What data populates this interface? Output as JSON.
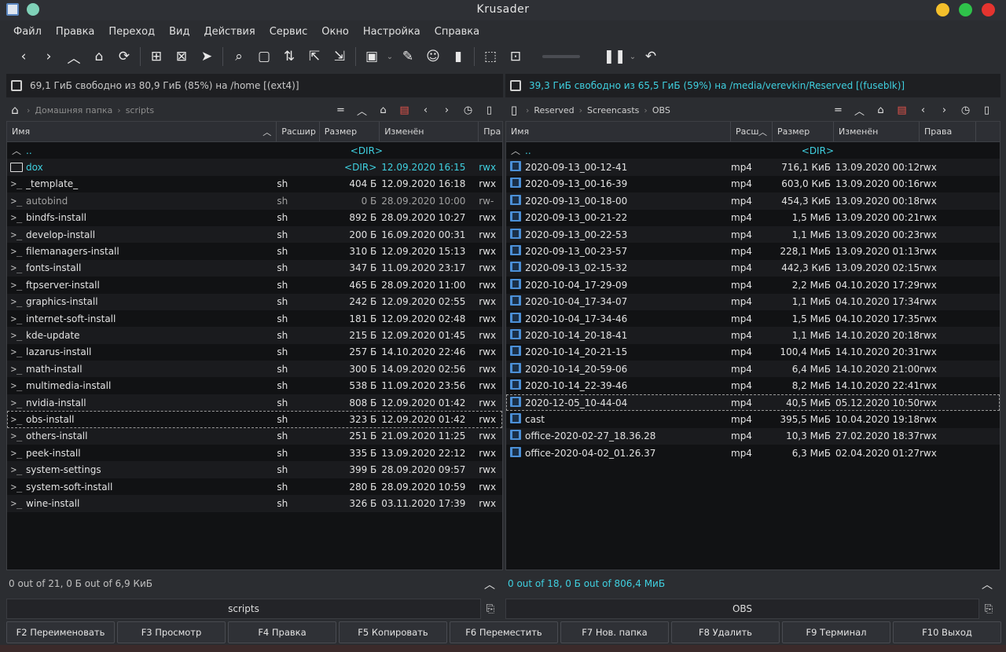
{
  "window": {
    "title": "Krusader"
  },
  "colors": {
    "accent": "#3fd0e0",
    "minimize": "#f4bf2b",
    "maximize": "#2fc24a",
    "close": "#e5342f"
  },
  "menu": [
    "Файл",
    "Правка",
    "Переход",
    "Вид",
    "Действия",
    "Сервис",
    "Окно",
    "Настройка",
    "Справка"
  ],
  "left": {
    "free": "69,1 ГиБ свободно из 80,9 ГиБ (85%) на /home [(ext4)]",
    "breadcrumb": [
      "Домашняя папка",
      "scripts"
    ],
    "columns": {
      "name": "Имя",
      "ext": "Расшир",
      "size": "Размер",
      "date": "Изменён",
      "perm": "Пра"
    },
    "updir": {
      "name": "..",
      "size": "<DIR>"
    },
    "rows": [
      {
        "icon": "folder-icon",
        "name": "dox",
        "ext": "",
        "size": "<DIR>",
        "date": "12.09.2020 16:15",
        "perm": "rwx",
        "dir": true
      },
      {
        "icon": "script-icon",
        "name": "_template_",
        "ext": "sh",
        "size": "404 Б",
        "date": "12.09.2020 16:18",
        "perm": "rwx"
      },
      {
        "icon": "script-icon",
        "name": "autobind",
        "ext": "sh",
        "size": "0 Б",
        "date": "28.09.2020 10:00",
        "perm": "rw-",
        "dim": true
      },
      {
        "icon": "script-icon",
        "name": "bindfs-install",
        "ext": "sh",
        "size": "892 Б",
        "date": "28.09.2020 10:27",
        "perm": "rwx"
      },
      {
        "icon": "script-icon",
        "name": "develop-install",
        "ext": "sh",
        "size": "200 Б",
        "date": "16.09.2020 00:31",
        "perm": "rwx"
      },
      {
        "icon": "script-icon",
        "name": "filemanagers-install",
        "ext": "sh",
        "size": "310 Б",
        "date": "12.09.2020 15:13",
        "perm": "rwx"
      },
      {
        "icon": "script-icon",
        "name": "fonts-install",
        "ext": "sh",
        "size": "347 Б",
        "date": "11.09.2020 23:17",
        "perm": "rwx"
      },
      {
        "icon": "script-icon",
        "name": "ftpserver-install",
        "ext": "sh",
        "size": "465 Б",
        "date": "28.09.2020 11:00",
        "perm": "rwx"
      },
      {
        "icon": "script-icon",
        "name": "graphics-install",
        "ext": "sh",
        "size": "242 Б",
        "date": "12.09.2020 02:55",
        "perm": "rwx"
      },
      {
        "icon": "script-icon",
        "name": "internet-soft-install",
        "ext": "sh",
        "size": "181 Б",
        "date": "12.09.2020 02:48",
        "perm": "rwx"
      },
      {
        "icon": "script-icon",
        "name": "kde-update",
        "ext": "sh",
        "size": "215 Б",
        "date": "12.09.2020 01:45",
        "perm": "rwx"
      },
      {
        "icon": "script-icon",
        "name": "lazarus-install",
        "ext": "sh",
        "size": "257 Б",
        "date": "14.10.2020 22:46",
        "perm": "rwx"
      },
      {
        "icon": "script-icon",
        "name": "math-install",
        "ext": "sh",
        "size": "300 Б",
        "date": "14.09.2020 02:56",
        "perm": "rwx"
      },
      {
        "icon": "script-icon",
        "name": "multimedia-install",
        "ext": "sh",
        "size": "538 Б",
        "date": "11.09.2020 23:56",
        "perm": "rwx"
      },
      {
        "icon": "script-icon",
        "name": "nvidia-install",
        "ext": "sh",
        "size": "808 Б",
        "date": "12.09.2020 01:42",
        "perm": "rwx"
      },
      {
        "icon": "script-icon",
        "name": "obs-install",
        "ext": "sh",
        "size": "323 Б",
        "date": "12.09.2020 01:42",
        "perm": "rwx",
        "focus": true
      },
      {
        "icon": "script-icon",
        "name": "others-install",
        "ext": "sh",
        "size": "251 Б",
        "date": "21.09.2020 11:25",
        "perm": "rwx"
      },
      {
        "icon": "script-icon",
        "name": "peek-install",
        "ext": "sh",
        "size": "335 Б",
        "date": "13.09.2020 22:12",
        "perm": "rwx"
      },
      {
        "icon": "script-icon",
        "name": "system-settings",
        "ext": "sh",
        "size": "399 Б",
        "date": "28.09.2020 09:57",
        "perm": "rwx"
      },
      {
        "icon": "script-icon",
        "name": "system-soft-install",
        "ext": "sh",
        "size": "280 Б",
        "date": "28.09.2020 10:59",
        "perm": "rwx"
      },
      {
        "icon": "script-icon",
        "name": "wine-install",
        "ext": "sh",
        "size": "326 Б",
        "date": "03.11.2020 17:39",
        "perm": "rwx"
      }
    ],
    "status": "0 out of 21, 0 Б out of 6,9 КиБ",
    "cmd": "scripts"
  },
  "right": {
    "free": "39,3 ГиБ свободно из 65,5 ГиБ (59%) на /media/verevkin/Reserved [(fuseblk)]",
    "breadcrumb": [
      "Reserved",
      "Screencasts",
      "OBS"
    ],
    "columns": {
      "name": "Имя",
      "ext": "Расш",
      "size": "Размер",
      "date": "Изменён",
      "perm": "Права"
    },
    "updir": {
      "name": "..",
      "size": "<DIR>"
    },
    "rows": [
      {
        "name": "2020-09-13_00-12-41",
        "ext": "mp4",
        "size": "716,1 КиБ",
        "date": "13.09.2020 00:12",
        "perm": "rwx"
      },
      {
        "name": "2020-09-13_00-16-39",
        "ext": "mp4",
        "size": "603,0 КиБ",
        "date": "13.09.2020 00:16",
        "perm": "rwx"
      },
      {
        "name": "2020-09-13_00-18-00",
        "ext": "mp4",
        "size": "454,3 КиБ",
        "date": "13.09.2020 00:18",
        "perm": "rwx"
      },
      {
        "name": "2020-09-13_00-21-22",
        "ext": "mp4",
        "size": "1,5 МиБ",
        "date": "13.09.2020 00:21",
        "perm": "rwx"
      },
      {
        "name": "2020-09-13_00-22-53",
        "ext": "mp4",
        "size": "1,1 МиБ",
        "date": "13.09.2020 00:23",
        "perm": "rwx"
      },
      {
        "name": "2020-09-13_00-23-57",
        "ext": "mp4",
        "size": "228,1 МиБ",
        "date": "13.09.2020 01:13",
        "perm": "rwx"
      },
      {
        "name": "2020-09-13_02-15-32",
        "ext": "mp4",
        "size": "442,3 КиБ",
        "date": "13.09.2020 02:15",
        "perm": "rwx"
      },
      {
        "name": "2020-10-04_17-29-09",
        "ext": "mp4",
        "size": "2,2 МиБ",
        "date": "04.10.2020 17:29",
        "perm": "rwx"
      },
      {
        "name": "2020-10-04_17-34-07",
        "ext": "mp4",
        "size": "1,1 МиБ",
        "date": "04.10.2020 17:34",
        "perm": "rwx"
      },
      {
        "name": "2020-10-04_17-34-46",
        "ext": "mp4",
        "size": "1,5 МиБ",
        "date": "04.10.2020 17:35",
        "perm": "rwx"
      },
      {
        "name": "2020-10-14_20-18-41",
        "ext": "mp4",
        "size": "1,1 МиБ",
        "date": "14.10.2020 20:18",
        "perm": "rwx"
      },
      {
        "name": "2020-10-14_20-21-15",
        "ext": "mp4",
        "size": "100,4 МиБ",
        "date": "14.10.2020 20:31",
        "perm": "rwx"
      },
      {
        "name": "2020-10-14_20-59-06",
        "ext": "mp4",
        "size": "6,4 МиБ",
        "date": "14.10.2020 21:00",
        "perm": "rwx"
      },
      {
        "name": "2020-10-14_22-39-46",
        "ext": "mp4",
        "size": "8,2 МиБ",
        "date": "14.10.2020 22:41",
        "perm": "rwx"
      },
      {
        "name": "2020-12-05_10-44-04",
        "ext": "mp4",
        "size": "40,5 МиБ",
        "date": "05.12.2020 10:50",
        "perm": "rwx",
        "focus": true
      },
      {
        "name": "cast",
        "ext": "mp4",
        "size": "395,5 МиБ",
        "date": "10.04.2020 19:18",
        "perm": "rwx"
      },
      {
        "name": "office-2020-02-27_18.36.28",
        "ext": "mp4",
        "size": "10,3 МиБ",
        "date": "27.02.2020 18:37",
        "perm": "rwx"
      },
      {
        "name": "office-2020-04-02_01.26.37",
        "ext": "mp4",
        "size": "6,3 МиБ",
        "date": "02.04.2020 01:27",
        "perm": "rwx"
      }
    ],
    "status": "0 out of 18, 0 Б out of 806,4 МиБ",
    "cmd": "OBS"
  },
  "fkeys": [
    "F2 Переименовать",
    "F3 Просмотр",
    "F4 Правка",
    "F5 Копировать",
    "F6 Переместить",
    "F7 Нов. папка",
    "F8 Удалить",
    "F9 Терминал",
    "F10 Выход"
  ]
}
